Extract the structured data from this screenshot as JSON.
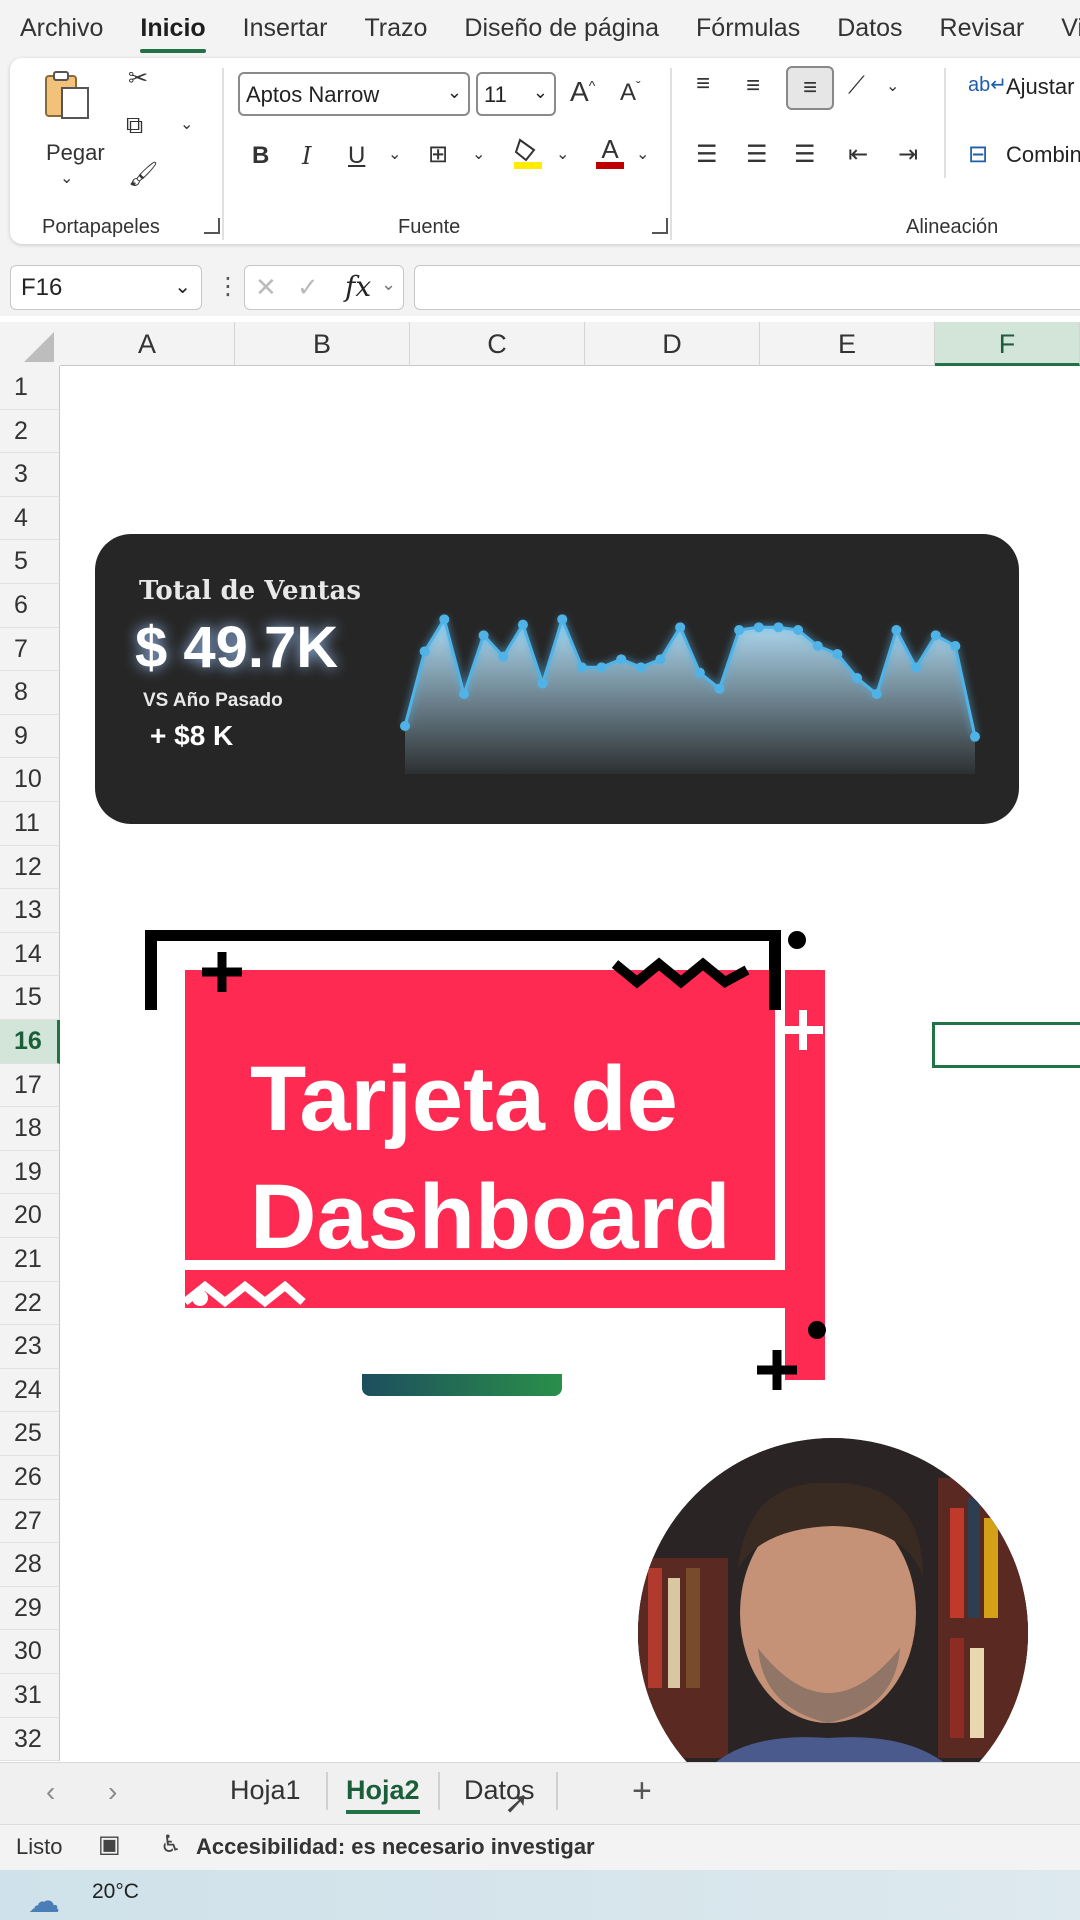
{
  "menu": [
    "Archivo",
    "Inicio",
    "Insertar",
    "Trazo",
    "Diseño de página",
    "Fórmulas",
    "Datos",
    "Revisar",
    "Vis"
  ],
  "ribbon": {
    "paste_label": "Pegar",
    "font_name": "Aptos Narrow",
    "font_size": "11",
    "wrap_label": "Ajustar",
    "merge_label": "Combin",
    "groups": {
      "clipboard": "Portapapeles",
      "font": "Fuente",
      "alignment": "Alineación"
    },
    "colors": {
      "highlight": "#ffeb00",
      "font_color": "#c00000"
    }
  },
  "formula_bar": {
    "name_box": "F16",
    "fx_label": "fx",
    "formula": ""
  },
  "grid": {
    "columns": [
      "A",
      "B",
      "C",
      "D",
      "E",
      "F"
    ],
    "selected_column": "F",
    "rows": [
      "1",
      "2",
      "3",
      "4",
      "5",
      "6",
      "7",
      "8",
      "9",
      "10",
      "11",
      "12",
      "13",
      "14",
      "15",
      "16",
      "17",
      "18",
      "19",
      "20",
      "21",
      "22",
      "23",
      "24",
      "25",
      "26",
      "27",
      "28",
      "29",
      "30",
      "31",
      "32"
    ],
    "selected_row": "16"
  },
  "sales_card": {
    "title": "Total de Ventas",
    "value": "$ 49.7K",
    "compare_label": "VS Año Pasado",
    "delta": "+ $8 K",
    "sparkline_values": [
      18,
      46,
      58,
      30,
      52,
      44,
      56,
      34,
      58,
      40,
      40,
      43,
      40,
      43,
      55,
      38,
      32,
      54,
      55,
      55,
      54,
      48,
      45,
      36,
      30,
      54,
      40,
      52,
      48,
      14
    ]
  },
  "overlay": {
    "title_line1": "Tarjeta de",
    "title_line2": "Dashboard",
    "colors": {
      "main": "#ff2a52",
      "frame": "#000000"
    }
  },
  "sheets": {
    "tabs": [
      "Hoja1",
      "Hoja2",
      "Datos"
    ],
    "active": "Hoja2",
    "add_label": "+"
  },
  "status": {
    "ready": "Listo",
    "accessibility": "Accesibilidad: es necesario investigar"
  },
  "taskbar": {
    "temperature": "20°C"
  }
}
